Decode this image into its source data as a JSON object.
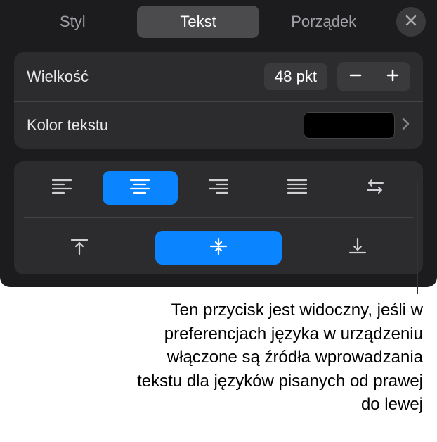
{
  "tabs": {
    "style": "Styl",
    "text": "Tekst",
    "arrange": "Porządek"
  },
  "size": {
    "label": "Wielkość",
    "value": "48 pkt"
  },
  "textColor": {
    "label": "Kolor tekstu",
    "swatch": "#000000"
  },
  "callout": "Ten przycisk jest widoczny, jeśli w preferencjach języka w urządzeniu włączone są źródła wprowadzania tekstu dla języków pisanych od prawej do lewej"
}
